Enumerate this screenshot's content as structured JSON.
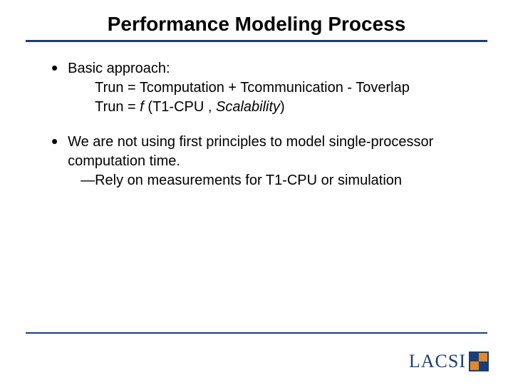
{
  "title": "Performance Modeling Process",
  "bullets": [
    {
      "lead": "Basic approach:",
      "lines": [
        "Trun = Tcomputation + Tcommunication - Toverlap",
        {
          "prefix": "Trun = ",
          "ital1": "f ",
          "mid": "(T1-CPU , ",
          "ital2": "Scalability",
          "suffix": ")"
        }
      ]
    },
    {
      "lead": "We are not using first principles to model single-processor computation time.",
      "sub": "—Rely on measurements for T1-CPU or simulation"
    }
  ],
  "logo": {
    "text": "LACSI"
  }
}
